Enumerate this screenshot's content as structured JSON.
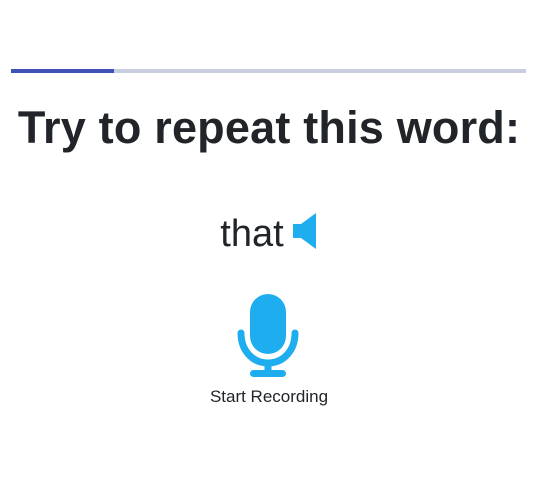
{
  "progress": {
    "fraction": 0.2
  },
  "prompt": {
    "title": "Try to repeat this word:"
  },
  "word": {
    "text": "that",
    "audio_icon": "speaker-icon"
  },
  "recorder": {
    "icon": "microphone-icon",
    "label": "Start Recording"
  },
  "colors": {
    "accent": "#1eaef0",
    "progress_fill": "#3f51b5",
    "progress_track": "#c8cde0"
  }
}
